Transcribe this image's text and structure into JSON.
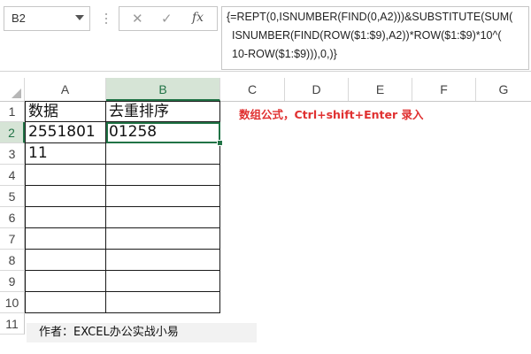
{
  "name_box": {
    "value": "B2"
  },
  "formula_bar": {
    "cancel_symbol": "✕",
    "enter_symbol": "✓",
    "fx_label": "fx",
    "formula_lines": [
      "{=REPT(0,ISNUMBER(FIND(0,A2)))&SUBSTITUTE(SUM(",
      "ISNUMBER(FIND(ROW($1:$9),A2))*ROW($1:$9)*10^(",
      "10-ROW($1:$9))),0,)}"
    ]
  },
  "columns": [
    "A",
    "B",
    "C",
    "D",
    "E",
    "F",
    "G"
  ],
  "rows": [
    "1",
    "2",
    "3",
    "4",
    "5",
    "6",
    "7",
    "8",
    "9",
    "10",
    "11"
  ],
  "selected": {
    "column": "B",
    "row": "2"
  },
  "cells": {
    "A1": "数据",
    "B1": "去重排序",
    "A2": "2551801",
    "B2": "01258",
    "A3": "11",
    "B3": ""
  },
  "annotation": "数组公式，Ctrl+shift+Enter 录入",
  "credit": "作者：EXCEL办公实战小易",
  "colors": {
    "accent_green": "#217346",
    "annotation_red": "#e03030"
  },
  "icons": {
    "name_box_dropdown": "chevron-down-icon",
    "cancel": "close-icon",
    "enter": "check-icon",
    "function": "fx-icon",
    "select_all": "select-all-triangle-icon"
  }
}
